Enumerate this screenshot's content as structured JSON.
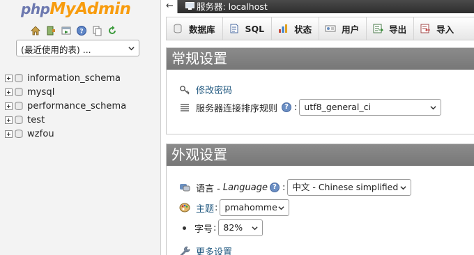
{
  "logo": {
    "part1": "php",
    "part2": "My",
    "part3": "Admin"
  },
  "nav_icons": [
    "home-icon",
    "logout-icon",
    "query-window-icon",
    "docs-icon",
    "copy-icon",
    "reload-icon"
  ],
  "recent_tables": {
    "selected": "(最近使用的表) ..."
  },
  "databases": [
    {
      "name": "information_schema"
    },
    {
      "name": "mysql"
    },
    {
      "name": "performance_schema"
    },
    {
      "name": "test"
    },
    {
      "name": "wzfou"
    }
  ],
  "topbar": {
    "back": "←",
    "server_label": "服务器: localhost"
  },
  "tabs": [
    {
      "label": "数据库",
      "icon": "database-icon"
    },
    {
      "label": "SQL",
      "icon": "sql-icon"
    },
    {
      "label": "状态",
      "icon": "status-icon"
    },
    {
      "label": "用户",
      "icon": "users-icon"
    },
    {
      "label": "导出",
      "icon": "export-icon"
    },
    {
      "label": "导入",
      "icon": "import-icon"
    }
  ],
  "general": {
    "title": "常规设置",
    "change_password": "修改密码",
    "collation_label": "服务器连接排序规则",
    "collation_value": "utf8_general_ci"
  },
  "appearance": {
    "title": "外观设置",
    "language_label": "语言 - ",
    "language_italic": "Language",
    "language_value": "中文 - Chinese simplified",
    "theme_label": "主题",
    "theme_value": "pmahomme",
    "fontsize_label": "字号",
    "fontsize_value": "82%",
    "more_settings": "更多设置"
  },
  "help_glyph": "?",
  "colors": {
    "link": "#235a81",
    "section_header": "#808080",
    "logo_orange": "#f89c0e",
    "logo_blue": "#6c78af"
  }
}
